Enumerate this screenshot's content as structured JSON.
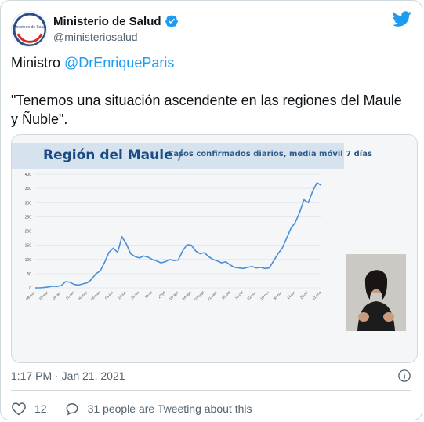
{
  "tweet": {
    "author_name": "Ministerio de Salud",
    "author_handle": "@ministeriosalud",
    "avatar_text": "Ministerio de Salud",
    "text_prefix": "Ministro ",
    "mention": "@DrEnriqueParis",
    "quote": "\"Tenemos una situación ascendente en las regiones del Maule y Ñuble\".",
    "timestamp": "1:17 PM · Jan 21, 2021",
    "likes": "12",
    "tweeting": "31 people are Tweeting about this"
  },
  "colors": {
    "twitter_blue": "#1d9bf0",
    "line_color": "#4a8fd6",
    "banner_title": "#174b82"
  },
  "icons": [
    "verified-badge-icon",
    "twitter-bird-icon",
    "info-icon",
    "heart-icon",
    "reply-bubble-icon"
  ],
  "chart_data": {
    "type": "line",
    "title": "Región del Maule",
    "subtitle": "Casos confirmados diarios, media móvil 7 días",
    "ylim": [
      0,
      400
    ],
    "yticks": [
      0,
      50,
      100,
      150,
      200,
      250,
      300,
      350,
      400
    ],
    "xtick_labels": [
      "09-mar",
      "23-mar",
      "06-abr",
      "20-abr",
      "04-may",
      "18-may",
      "01-jun",
      "15-jun",
      "29-jun",
      "13-jul",
      "27-jul",
      "10-ago",
      "24-ago",
      "07-sept",
      "21-sept",
      "05-oct",
      "19-oct",
      "02-nov",
      "16-nov",
      "30-nov",
      "14-dic",
      "28-dic",
      "11-ene"
    ],
    "grid": true,
    "series": [
      {
        "values": [
          0,
          0,
          1,
          3,
          6,
          5,
          8,
          22,
          20,
          12,
          10,
          14,
          18,
          30,
          50,
          60,
          90,
          125,
          140,
          125,
          180,
          155,
          120,
          110,
          105,
          112,
          108,
          100,
          95,
          88,
          92,
          100,
          96,
          98,
          130,
          152,
          150,
          130,
          120,
          124,
          110,
          100,
          95,
          88,
          92,
          80,
          72,
          70,
          68,
          72,
          75,
          70,
          72,
          68,
          70,
          95,
          120,
          140,
          175,
          210,
          230,
          265,
          310,
          300,
          340,
          370,
          360
        ]
      }
    ]
  }
}
